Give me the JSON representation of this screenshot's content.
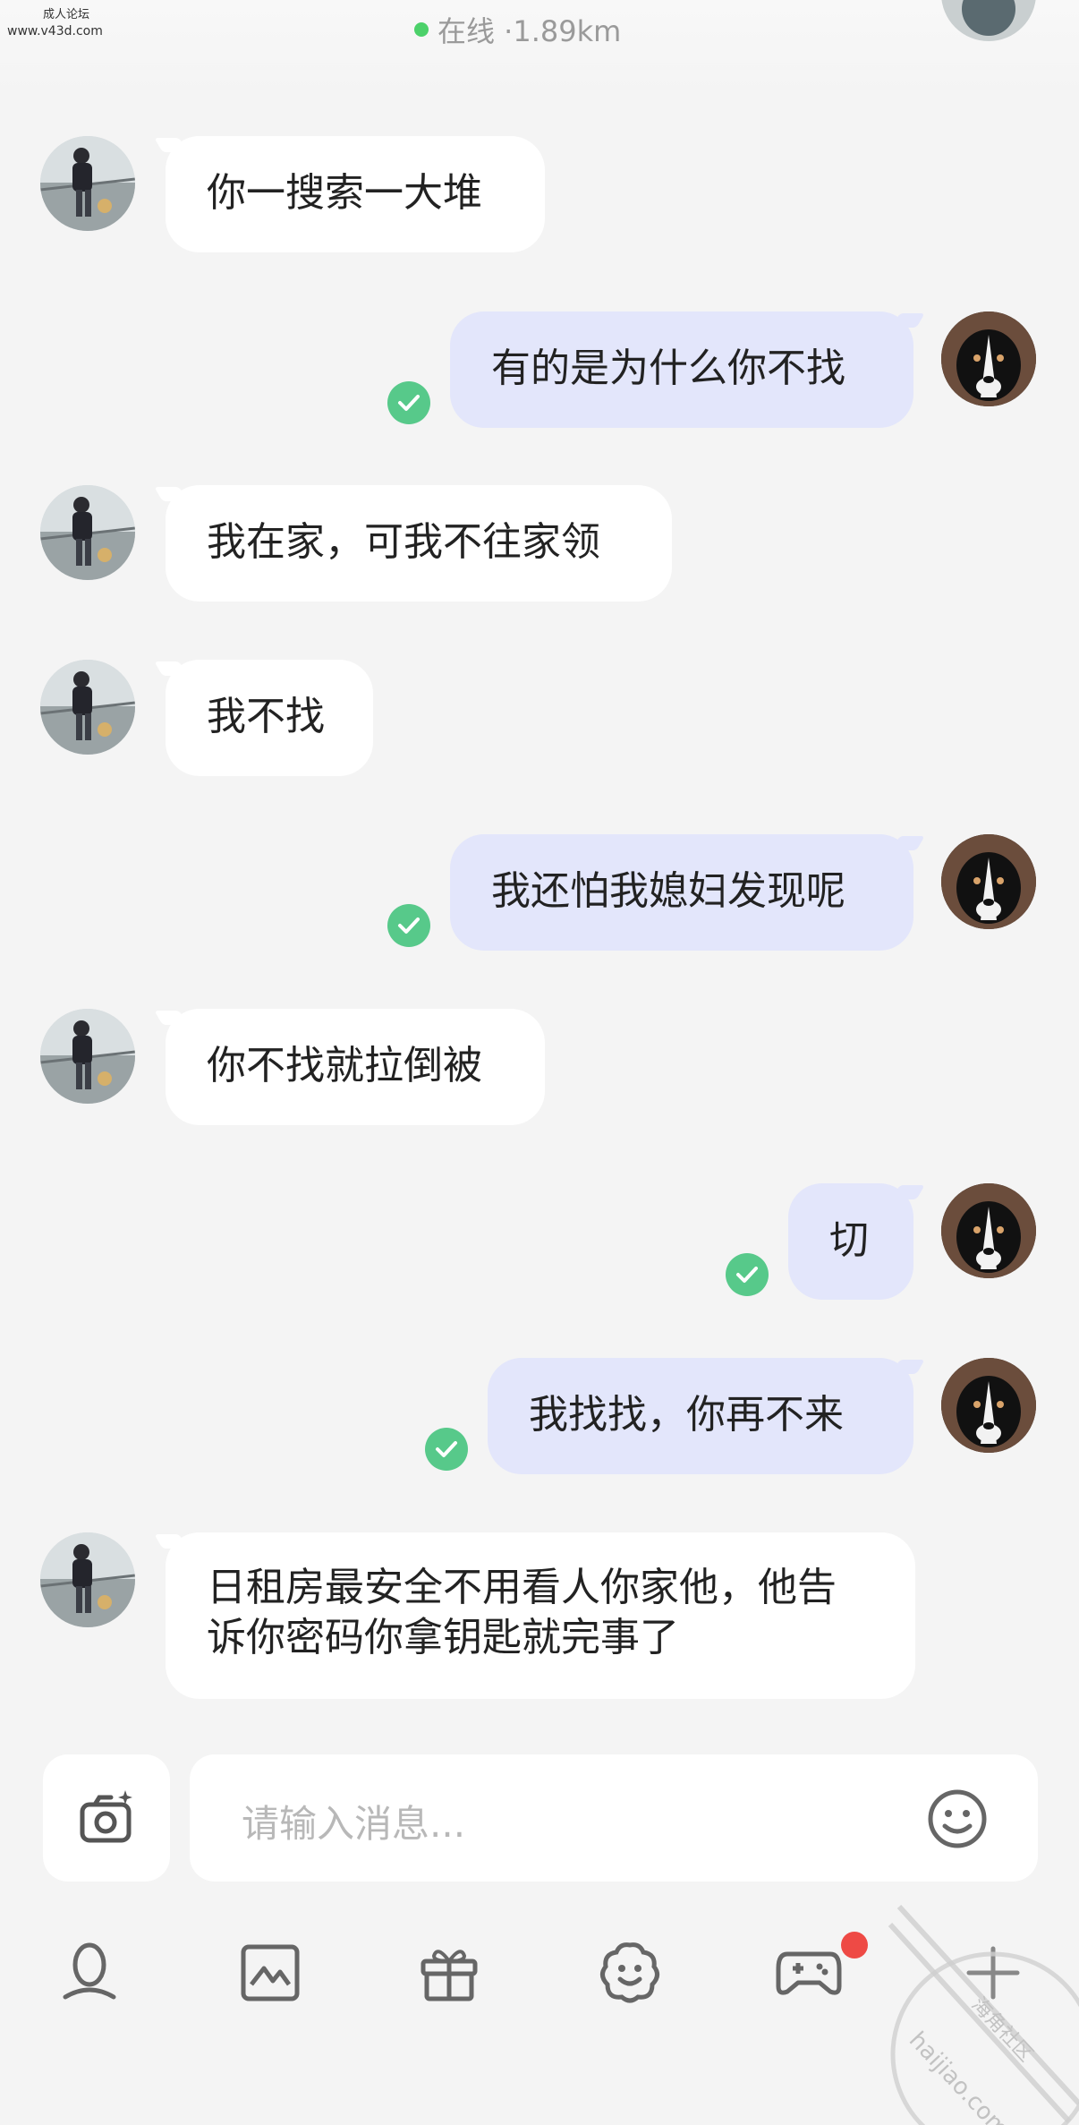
{
  "watermark": {
    "top_left_line1": "成人论坛",
    "top_left_line2": "www.v43d.com",
    "stamp_text": "haijiao.com",
    "stamp_text_cn": "海角社区"
  },
  "header": {
    "status": "在线 ·1.89km",
    "status_color": "#4cd16a"
  },
  "colors": {
    "incoming_bubble": "#ffffff",
    "outgoing_bubble": "#e3e6fb",
    "read_check": "#57c98a",
    "background": "#f4f4f4"
  },
  "messages": [
    {
      "side": "left",
      "text": "你一搜索一大堆"
    },
    {
      "side": "right",
      "text": "有的是为什么你不找",
      "read": true
    },
    {
      "side": "left",
      "text": "我在家，可我不往家领"
    },
    {
      "side": "left",
      "text": "我不找"
    },
    {
      "side": "right",
      "text": "我还怕我媳妇发现呢",
      "read": true
    },
    {
      "side": "left",
      "text": "你不找就拉倒被"
    },
    {
      "side": "right",
      "text": "切",
      "read": true
    },
    {
      "side": "right",
      "text": "我找找，你再不来",
      "read": true
    },
    {
      "side": "left",
      "text": "日租房最安全不用看人你家他，他告诉你密码你拿钥匙就完事了"
    }
  ],
  "composer": {
    "placeholder": "请输入消息...",
    "camera_icon": "camera-sparkle-icon",
    "emoji_icon": "smiley-icon"
  },
  "toolbar": {
    "items": [
      "voice-icon",
      "image-icon",
      "gift-icon",
      "sticker-icon",
      "game-icon",
      "plus-icon"
    ],
    "game_has_badge": true
  }
}
